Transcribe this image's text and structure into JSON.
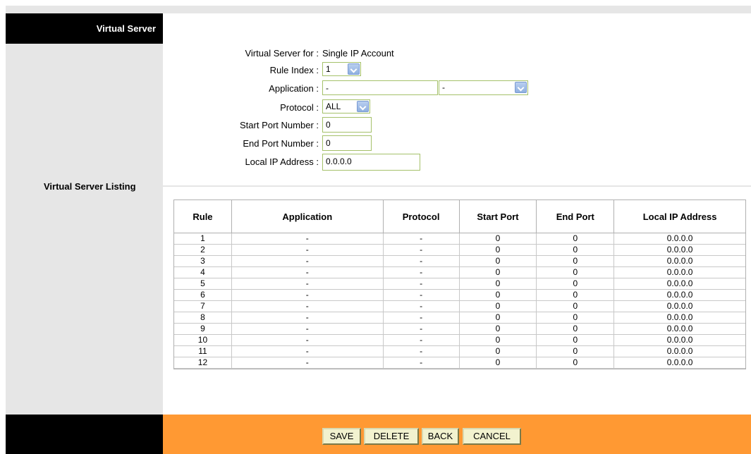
{
  "sidebar": {
    "title": "Virtual Server",
    "listing_title": "Virtual Server Listing"
  },
  "form": {
    "virtual_server_for_label": "Virtual Server for :",
    "virtual_server_for_value": "Single IP Account",
    "rule_index_label": "Rule Index :",
    "rule_index_value": "1",
    "application_label": "Application :",
    "application_value": "-",
    "application_select_value": "-",
    "protocol_label": "Protocol :",
    "protocol_value": "ALL",
    "start_port_label": "Start Port Number :",
    "start_port_value": "0",
    "end_port_label": "End Port Number :",
    "end_port_value": "0",
    "local_ip_label": "Local IP Address :",
    "local_ip_value": "0.0.0.0"
  },
  "table": {
    "headers": [
      "Rule",
      "Application",
      "Protocol",
      "Start Port",
      "End Port",
      "Local IP Address"
    ],
    "rows": [
      [
        "1",
        "-",
        "-",
        "0",
        "0",
        "0.0.0.0"
      ],
      [
        "2",
        "-",
        "-",
        "0",
        "0",
        "0.0.0.0"
      ],
      [
        "3",
        "-",
        "-",
        "0",
        "0",
        "0.0.0.0"
      ],
      [
        "4",
        "-",
        "-",
        "0",
        "0",
        "0.0.0.0"
      ],
      [
        "5",
        "-",
        "-",
        "0",
        "0",
        "0.0.0.0"
      ],
      [
        "6",
        "-",
        "-",
        "0",
        "0",
        "0.0.0.0"
      ],
      [
        "7",
        "-",
        "-",
        "0",
        "0",
        "0.0.0.0"
      ],
      [
        "8",
        "-",
        "-",
        "0",
        "0",
        "0.0.0.0"
      ],
      [
        "9",
        "-",
        "-",
        "0",
        "0",
        "0.0.0.0"
      ],
      [
        "10",
        "-",
        "-",
        "0",
        "0",
        "0.0.0.0"
      ],
      [
        "11",
        "-",
        "-",
        "0",
        "0",
        "0.0.0.0"
      ],
      [
        "12",
        "-",
        "-",
        "0",
        "0",
        "0.0.0.0"
      ]
    ]
  },
  "buttons": {
    "save": "SAVE",
    "delete": "DELETE",
    "back": "BACK",
    "cancel": "CANCEL"
  },
  "colors": {
    "footer_orange": "#ff9933",
    "sidebar_gray": "#e6e6e6",
    "input_border": "#a5c16a"
  }
}
